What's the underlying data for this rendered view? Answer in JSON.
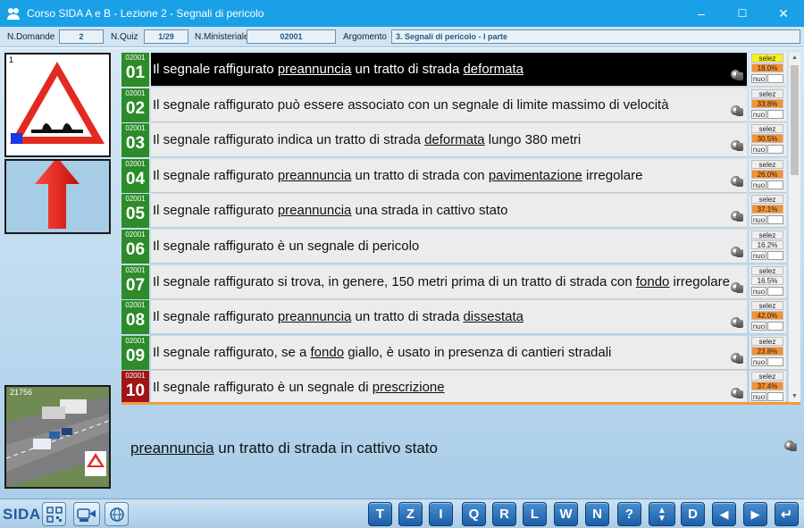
{
  "window": {
    "title": "Corso SIDA A e B - Lezione 2 - Segnali di pericolo",
    "minimize": "–",
    "maximize": "☐",
    "close": "✕"
  },
  "info": {
    "domande_label": "N.Domande",
    "domande_value": "2",
    "quiz_label": "N.Quiz",
    "quiz_value": "1/29",
    "ministeriale_label": "N.Ministeriale",
    "ministeriale_value": "02001",
    "argomento_label": "Argomento",
    "argomento_value": "3. Segnali di pericolo - I parte"
  },
  "sign_number": "1",
  "photo_code": "21756",
  "questions": [
    {
      "code": "02001",
      "num": "01",
      "color": "green",
      "selected": true,
      "parts": [
        [
          "Il segnale raffigurato ",
          false
        ],
        [
          "preannuncia",
          true
        ],
        [
          " un tratto di strada ",
          false
        ],
        [
          "deformata",
          true
        ]
      ],
      "selez": "selez",
      "selez_yellow": true,
      "pct": "18.0%",
      "pct_orange": true,
      "nuo": "nuo"
    },
    {
      "code": "02001",
      "num": "02",
      "color": "green",
      "selected": false,
      "parts": [
        [
          "Il segnale raffigurato può essere associato con un segnale di limite massimo di velocità",
          false
        ]
      ],
      "selez": "selez",
      "selez_yellow": false,
      "pct": "33.8%",
      "pct_orange": true,
      "nuo": "nuo"
    },
    {
      "code": "02001",
      "num": "03",
      "color": "green",
      "selected": false,
      "parts": [
        [
          "Il segnale raffigurato indica un tratto di strada ",
          false
        ],
        [
          "deformata",
          true
        ],
        [
          " lungo 380 metri",
          false
        ]
      ],
      "selez": "selez",
      "selez_yellow": false,
      "pct": "30.5%",
      "pct_orange": true,
      "nuo": "nuo"
    },
    {
      "code": "02001",
      "num": "04",
      "color": "green",
      "selected": false,
      "parts": [
        [
          "Il segnale raffigurato ",
          false
        ],
        [
          "preannuncia",
          true
        ],
        [
          " un tratto di strada con ",
          false
        ],
        [
          "pavimentazione",
          true
        ],
        [
          " irregolare",
          false
        ]
      ],
      "selez": "selez",
      "selez_yellow": false,
      "pct": "26.0%",
      "pct_orange": true,
      "nuo": "nuo"
    },
    {
      "code": "02001",
      "num": "05",
      "color": "green",
      "selected": false,
      "parts": [
        [
          "Il segnale raffigurato ",
          false
        ],
        [
          "preannuncia",
          true
        ],
        [
          " una strada in cattivo stato",
          false
        ]
      ],
      "selez": "selez",
      "selez_yellow": false,
      "pct": "37.1%",
      "pct_orange": true,
      "nuo": "nuo"
    },
    {
      "code": "02001",
      "num": "06",
      "color": "green",
      "selected": false,
      "parts": [
        [
          "Il segnale raffigurato è un segnale di pericolo",
          false
        ]
      ],
      "selez": "selez",
      "selez_yellow": false,
      "pct": "16.2%",
      "pct_orange": false,
      "nuo": "nuo"
    },
    {
      "code": "02001",
      "num": "07",
      "color": "green",
      "selected": false,
      "parts": [
        [
          "Il segnale raffigurato si trova, in genere, 150 metri prima di un tratto di strada con ",
          false
        ],
        [
          "fondo",
          true
        ],
        [
          " irregolare",
          false
        ]
      ],
      "selez": "selez",
      "selez_yellow": false,
      "pct": "16.5%",
      "pct_orange": false,
      "nuo": "nuo"
    },
    {
      "code": "02001",
      "num": "08",
      "color": "green",
      "selected": false,
      "parts": [
        [
          "Il segnale raffigurato ",
          false
        ],
        [
          "preannuncia",
          true
        ],
        [
          " un tratto di strada ",
          false
        ],
        [
          "dissestata",
          true
        ]
      ],
      "selez": "selez",
      "selez_yellow": false,
      "pct": "42.0%",
      "pct_orange": true,
      "nuo": "nuo"
    },
    {
      "code": "02001",
      "num": "09",
      "color": "green",
      "selected": false,
      "parts": [
        [
          "Il segnale raffigurato, se a ",
          false
        ],
        [
          "fondo",
          true
        ],
        [
          " giallo, è usato in presenza di cantieri stradali",
          false
        ]
      ],
      "selez": "selez",
      "selez_yellow": false,
      "pct": "23.8%",
      "pct_orange": true,
      "nuo": "nuo"
    },
    {
      "code": "02001",
      "num": "10",
      "color": "red",
      "selected": false,
      "parts": [
        [
          "Il segnale raffigurato è un segnale di ",
          false
        ],
        [
          "prescrizione",
          true
        ]
      ],
      "selez": "selez",
      "selez_yellow": false,
      "pct": "37.4%",
      "pct_orange": true,
      "nuo": "nuo"
    }
  ],
  "answer": {
    "parts": [
      [
        "preannuncia",
        true
      ],
      [
        " un tratto di strada in cattivo stato",
        false
      ]
    ]
  },
  "toolbar": {
    "logo": "SIDA",
    "buttons": [
      "T",
      "Z",
      "I",
      "Q",
      "R",
      "L",
      "W",
      "N",
      "?",
      "D"
    ],
    "colors": {
      "button": "#1c5ea6",
      "green": "#2d8b2a",
      "red": "#a01414",
      "orange": "#f7912f",
      "yellow": "#f7f21b",
      "accent": "#1aa0e6"
    }
  }
}
